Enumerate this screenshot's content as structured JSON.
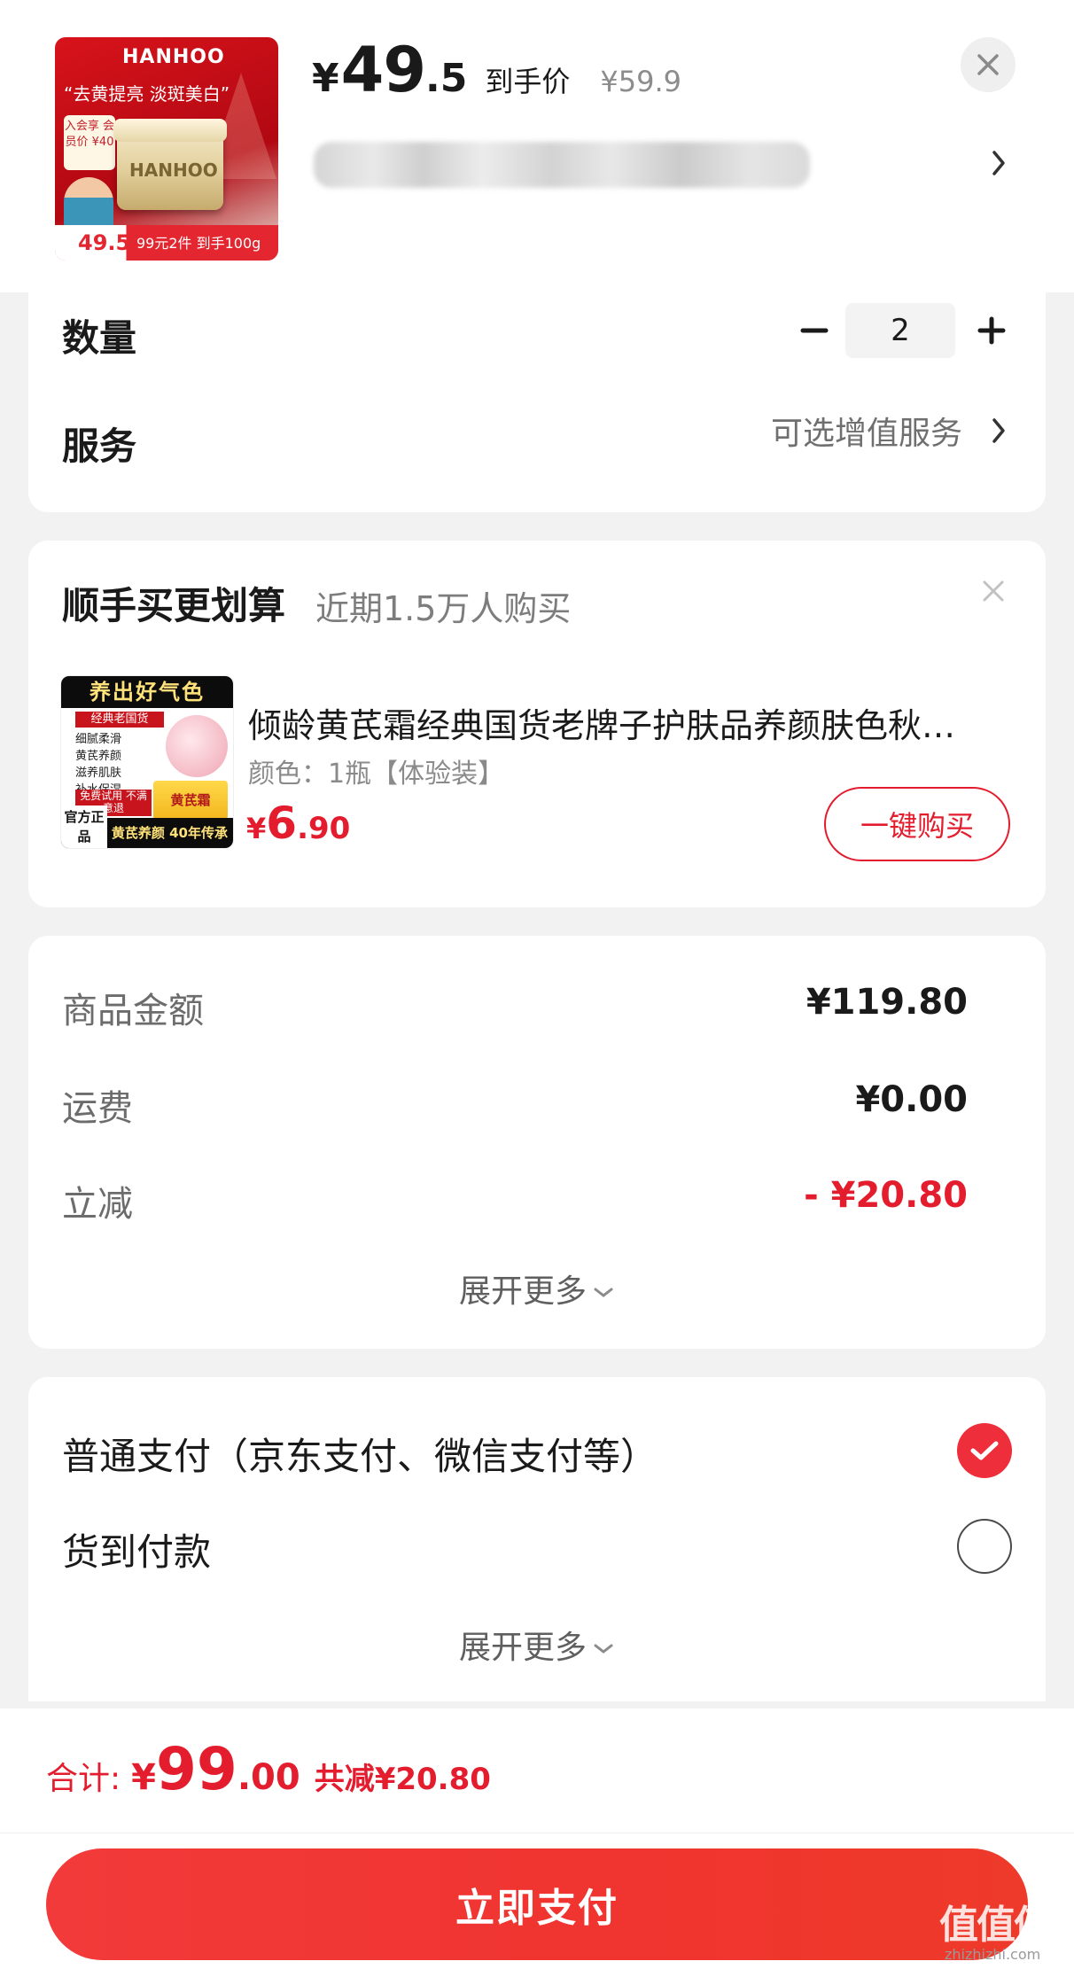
{
  "product": {
    "thumb_brand": "HANHOO",
    "thumb_slogan": "“去黄提亮 淡斑美白”",
    "thumb_vip": "入会享 会员价 ¥40",
    "thumb_jar_text": "HANHOO",
    "thumb_strip_price": "49.5",
    "thumb_strip_text": "99元2件 到手100g",
    "price_yen": "¥",
    "price_int": "49",
    "price_dec": ".5",
    "price_tag": "到手价",
    "original_price": "¥59.9"
  },
  "options": {
    "quantity_label": "数量",
    "quantity_value": "2",
    "service_label": "服务",
    "service_value": "可选增值服务"
  },
  "recommendation": {
    "title": "顺手买更划算",
    "subtitle": "近期1.5万人购买",
    "thumb_banner": "养出好气色",
    "thumb_sub": "经典老国货",
    "thumb_bullets": [
      "细腻柔滑",
      "黄芪养颜",
      "滋养肌肤",
      "补水保湿"
    ],
    "thumb_box": "黄芪霜",
    "thumb_redbox": "免费试用 不满意退",
    "thumb_foot_badge": "官方正品",
    "thumb_foot": "黄芪养颜 40年传承",
    "name": "倾龄黄芪霜经典国货老牌子护肤品养颜肤色秋…",
    "spec": "颜色：1瓶【体验装】",
    "price_yen": "¥",
    "price_int": "6",
    "price_dec": ".90",
    "buy_label": "一键购买"
  },
  "summary": {
    "goods_label": "商品金额",
    "goods_value": "¥119.80",
    "shipping_label": "运费",
    "shipping_value": "¥0.00",
    "discount_label": "立减",
    "discount_value": "- ¥20.80",
    "expand_label": "展开更多"
  },
  "payment": {
    "normal_label": "普通支付（京东支付、微信支付等）",
    "cod_label": "货到付款",
    "expand_label": "展开更多",
    "normal_selected": true,
    "cod_selected": false
  },
  "footer": {
    "total_label": "合计:",
    "total_yen": "¥",
    "total_int": "99",
    "total_dec": ".00",
    "total_save": "共减¥20.80",
    "pay_label": "立即支付",
    "watermark": "值值值",
    "watermark_sub": "zhizhizhi.com"
  },
  "colors": {
    "accent_red": "#e31d2e",
    "pay_button": "#f23a3a",
    "background": "#f2f2f2"
  }
}
